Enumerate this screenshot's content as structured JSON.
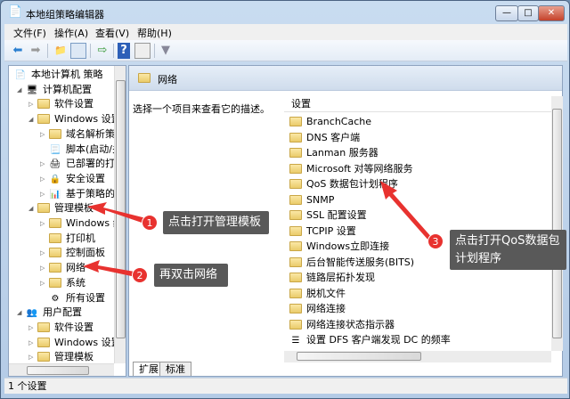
{
  "window": {
    "title": "本地组策略编辑器",
    "min": "—",
    "max": "□",
    "close": "✕"
  },
  "menu": [
    "文件(F)",
    "操作(A)",
    "查看(V)",
    "帮助(H)"
  ],
  "toolbar": {
    "back": "⬅",
    "forward": "➡",
    "up": "📁",
    "help": "?",
    "filter": "▼"
  },
  "tree": [
    {
      "label": "本地计算机 策略",
      "indent": 0,
      "exp": "",
      "icon": "policy"
    },
    {
      "label": "计算机配置",
      "indent": 1,
      "exp": "◢",
      "icon": "computer"
    },
    {
      "label": "软件设置",
      "indent": 2,
      "exp": "▷",
      "icon": "folder"
    },
    {
      "label": "Windows 设置",
      "indent": 2,
      "exp": "◢",
      "icon": "folder"
    },
    {
      "label": "域名解析策略",
      "indent": 3,
      "exp": "▷",
      "icon": "folder"
    },
    {
      "label": "脚本(启动/关机)",
      "indent": 3,
      "exp": "",
      "icon": "script"
    },
    {
      "label": "已部署的打印机",
      "indent": 3,
      "exp": "▷",
      "icon": "printer"
    },
    {
      "label": "安全设置",
      "indent": 3,
      "exp": "▷",
      "icon": "security"
    },
    {
      "label": "基于策略的 QoS",
      "indent": 3,
      "exp": "▷",
      "icon": "chart"
    },
    {
      "label": "管理模板",
      "indent": 2,
      "exp": "◢",
      "icon": "folder"
    },
    {
      "label": "Windows 组件",
      "indent": 3,
      "exp": "▷",
      "icon": "folder"
    },
    {
      "label": "打印机",
      "indent": 3,
      "exp": "",
      "icon": "folder"
    },
    {
      "label": "控制面板",
      "indent": 3,
      "exp": "▷",
      "icon": "folder"
    },
    {
      "label": "网络",
      "indent": 3,
      "exp": "▷",
      "icon": "folder"
    },
    {
      "label": "系统",
      "indent": 3,
      "exp": "▷",
      "icon": "folder"
    },
    {
      "label": "所有设置",
      "indent": 3,
      "exp": "",
      "icon": "settings"
    },
    {
      "label": "用户配置",
      "indent": 1,
      "exp": "◢",
      "icon": "user"
    },
    {
      "label": "软件设置",
      "indent": 2,
      "exp": "▷",
      "icon": "folder"
    },
    {
      "label": "Windows 设置",
      "indent": 2,
      "exp": "▷",
      "icon": "folder"
    },
    {
      "label": "管理模板",
      "indent": 2,
      "exp": "▷",
      "icon": "folder"
    }
  ],
  "right": {
    "header": "网络",
    "description": "选择一个项目来查看它的描述。",
    "column": "设置",
    "items": [
      {
        "label": "BranchCache",
        "icon": "folder"
      },
      {
        "label": "DNS 客户端",
        "icon": "folder"
      },
      {
        "label": "Lanman 服务器",
        "icon": "folder"
      },
      {
        "label": "Microsoft 对等网络服务",
        "icon": "folder"
      },
      {
        "label": "QoS 数据包计划程序",
        "icon": "folder"
      },
      {
        "label": "SNMP",
        "icon": "folder"
      },
      {
        "label": "SSL 配置设置",
        "icon": "folder"
      },
      {
        "label": "TCPIP 设置",
        "icon": "folder"
      },
      {
        "label": "Windows立即连接",
        "icon": "folder"
      },
      {
        "label": "后台智能传送服务(BITS)",
        "icon": "folder"
      },
      {
        "label": "链路层拓扑发现",
        "icon": "folder"
      },
      {
        "label": "脱机文件",
        "icon": "folder"
      },
      {
        "label": "网络连接",
        "icon": "folder"
      },
      {
        "label": "网络连接状态指示器",
        "icon": "folder"
      },
      {
        "label": "设置 DFS 客户端发现 DC 的频率",
        "icon": "setting"
      }
    ],
    "tabs": [
      "扩展",
      "标准"
    ]
  },
  "status": "1 个设置",
  "annotations": [
    {
      "num": "1",
      "text": "点击打开管理模板"
    },
    {
      "num": "2",
      "text": "再双击网络"
    },
    {
      "num": "3",
      "text": "点击打开QoS数据包计划程序"
    }
  ],
  "colors": {
    "annotation_red": "#e8322f",
    "callout_bg": "#595959"
  }
}
